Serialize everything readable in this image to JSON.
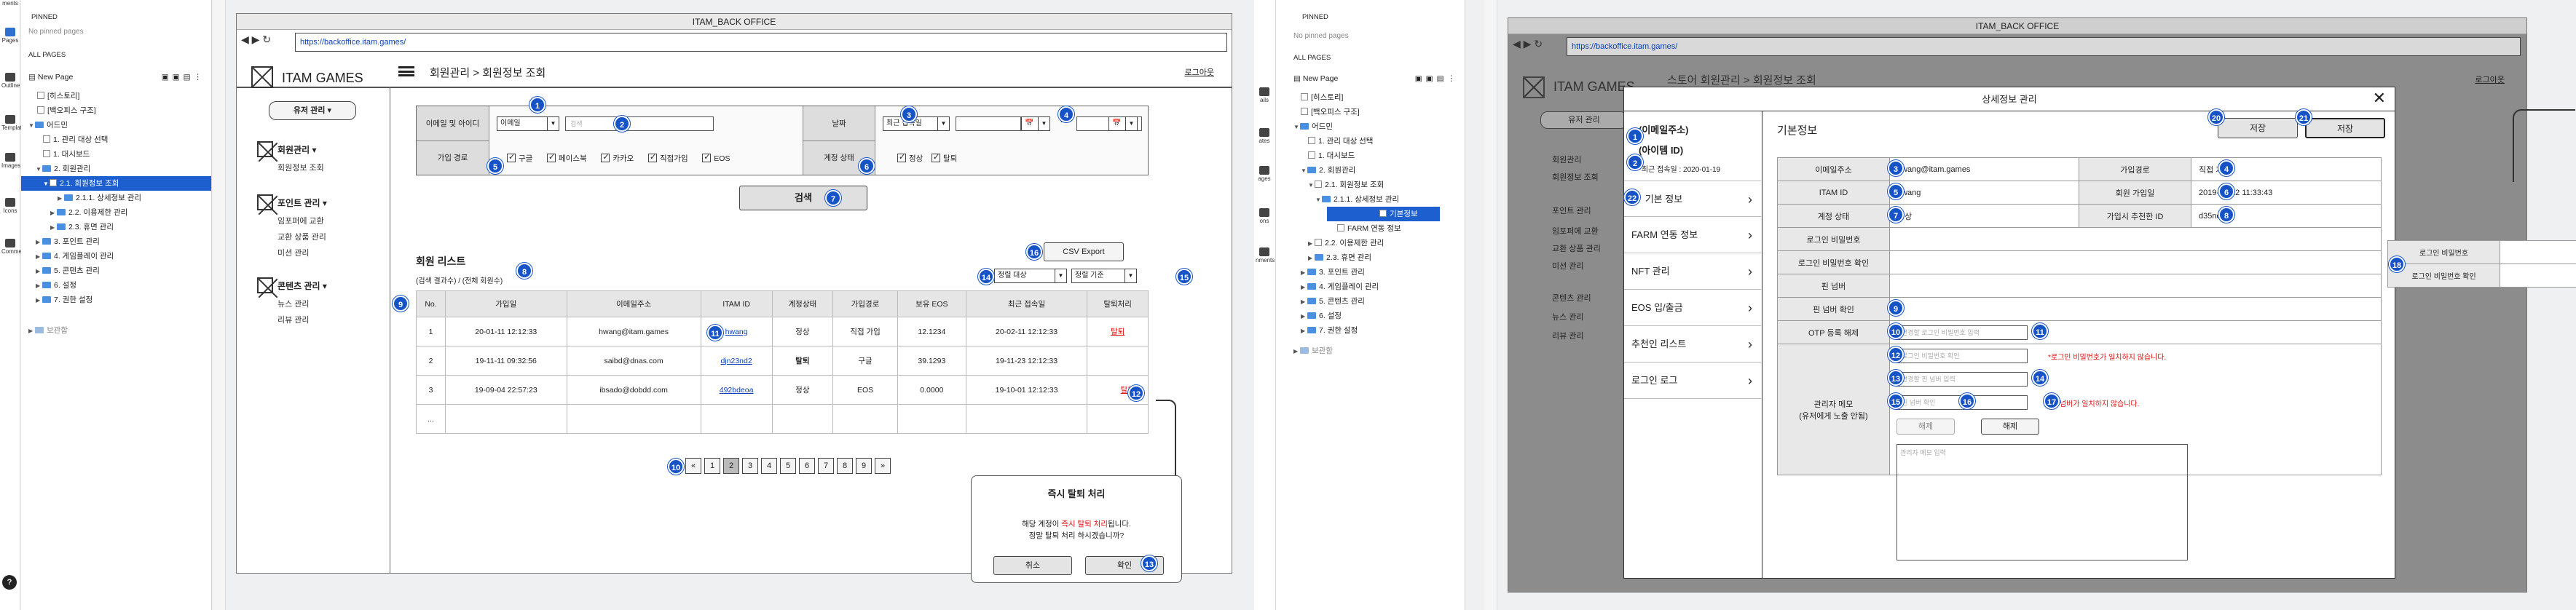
{
  "left_pane": {
    "rail": [
      "ments",
      "Pages",
      "Outline",
      "Templates",
      "Images",
      "Icons",
      "Comments"
    ],
    "pinned": "PINNED",
    "no_pinned": "No pinned pages",
    "all_pages": "ALL PAGES",
    "new_page": "New Page",
    "tree": [
      "[히스토리]",
      "[백오피스 구조]",
      "어드민",
      "1. 관리 대상 선택",
      "1. 대시보드",
      "2. 회원관리",
      "2.1. 회원정보 조회",
      "2.1.1. 상세정보 관리",
      "2.2. 이용제한 관리",
      "2.3. 휴면 관리",
      "3. 포인트 관리",
      "4. 게임플레이 관리",
      "5. 콘텐츠 관리",
      "6. 설정",
      "7. 권한 설정",
      "보관함"
    ]
  },
  "main1": {
    "window_title": "ITAM_BACK OFFICE",
    "url": "https://backoffice.itam.games/",
    "logo": "ITAM GAMES",
    "breadcrumb": "회원관리 > 회원정보 조회",
    "logout": "로그아웃",
    "user_menu": "유저 관리",
    "side": {
      "g1": "회원관리",
      "g1_items": [
        "회원정보 조회"
      ],
      "g2": "포인트 관리",
      "g2_items": [
        "임포퍼에 교환",
        "교환 상품 관리",
        "미션 관리"
      ],
      "g3": "콘텐츠 관리",
      "g3_items": [
        "뉴스 관리",
        "리뷰 관리"
      ]
    },
    "filter": {
      "label_email": "이메일 및 아이디",
      "email_select": "이메일",
      "search_placeholder": "검색",
      "label_date": "날짜",
      "date_select": "최근 접속일",
      "tilde": "~",
      "label_signup": "가입 경로",
      "signup": [
        "구글",
        "페이스북",
        "카카오",
        "직접가입",
        "EOS"
      ],
      "label_status": "계정 상태",
      "status": [
        "정상",
        "탈퇴"
      ],
      "search_btn": "검색"
    },
    "list": {
      "title": "회원 리스트",
      "sub": "(검색 결과수) / (전체 회원수)",
      "csv": "CSV Export",
      "sort1": "정렬 대상",
      "sort2": "정렬 기준",
      "headers": [
        "No.",
        "가입일",
        "이메일주소",
        "ITAM ID",
        "계정상태",
        "가입경로",
        "보유 EOS",
        "최근 접속일",
        "탈퇴처리"
      ],
      "rows": [
        [
          "1",
          "20-01-11 12:12:33",
          "hwang@itam.games",
          "hwang",
          "정상",
          "직접 가입",
          "12.1234",
          "20-02-11 12:12:33",
          "탈퇴"
        ],
        [
          "2",
          "19-11-11 09:32:56",
          "saibd@dnas.com",
          "djn23nd2",
          "탈퇴",
          "구글",
          "39.1293",
          "19-11-23 12:12:33",
          ""
        ],
        [
          "3",
          "19-09-04 22:57:23",
          "ibsado@dobdd.com",
          "492bdeoa",
          "정상",
          "EOS",
          "0.0000",
          "19-10-01 12:12:33",
          "탈퇴"
        ],
        [
          "...",
          "",
          "",
          "",
          "",
          "",
          "",
          "",
          ""
        ]
      ],
      "pages": [
        "«",
        "1",
        "2",
        "3",
        "4",
        "5",
        "6",
        "7",
        "8",
        "9",
        "»"
      ]
    },
    "popup": {
      "title": "즉시 탈퇴 처리",
      "line1_a": "해당 계정이 ",
      "line1_red": "즉시 탈퇴 처리",
      "line1_b": "됩니다.",
      "line2": "정말 탈퇴 처리 하시겠습니까?",
      "cancel": "취소",
      "ok": "확인"
    },
    "badges": [
      "1",
      "2",
      "3",
      "4",
      "5",
      "6",
      "7",
      "8",
      "9",
      "10",
      "11",
      "12",
      "13",
      "14",
      "15",
      "16"
    ]
  },
  "mid_pane": {
    "tree": [
      "[히스토리]",
      "[백오피스 구조]",
      "어드민",
      "1. 관리 대상 선택",
      "1. 대시보드",
      "2. 회원관리",
      "2.1. 회원정보 조회",
      "2.1.1. 상세정보 관리",
      "기본정보",
      "FARM 연동 정보",
      "2.2. 이용제한 관리",
      "2.3. 휴면 관리",
      "3. 포인트 관리",
      "4. 게임플레이 관리",
      "5. 콘텐츠 관리",
      "6. 설정",
      "7. 권한 설정",
      "보관함"
    ],
    "rail": [
      "ails",
      "ates",
      "ages",
      "ons",
      "nments"
    ]
  },
  "main2": {
    "window_title": "ITAM_BACK OFFICE",
    "url": "https://backoffice.itam.games/",
    "logo": "ITAM GAMES",
    "breadcrumb": "스토어 회원관리 > 회원정보 조회",
    "logout": "로그아웃",
    "user_menu": "유저 관리",
    "side_bg": [
      "회원관리",
      "회원정보 조회",
      "포인트 관리",
      "임포퍼에 교환",
      "교환 상품 관리",
      "미션 관리",
      "콘텐츠 관리",
      "뉴스 관리",
      "리뷰 관리"
    ],
    "modal": {
      "title": "상세정보 관리",
      "email_hdr": "(이메일주소)",
      "id_hdr": "(아이템 ID)",
      "last_login": "*최근 접속일 : 2020-01-19",
      "tabs": [
        "기본 정보",
        "FARM 연동 정보",
        "NFT 관리",
        "EOS 입/출금",
        "추천인 리스트",
        "로그인 로그"
      ],
      "section": "기본정보",
      "save1": "저장",
      "save2": "저장",
      "f": {
        "email_k": "이메일주소",
        "email_v": "hwang@itam.games",
        "route_k": "가입경로",
        "route_v": "직접 가입",
        "id_k": "ITAM ID",
        "id_v": "hwang",
        "joined_k": "회원 가입일",
        "joined_v": "2019-03-12 11:33:43",
        "status_k": "계정 상태",
        "status_v": "정상",
        "ref_k": "가입시 추천한 ID",
        "ref_v": "d35nod2i",
        "pw_k": "로그인 비밀번호",
        "pw_ph": "변경할 로그인 비밀번호 입력",
        "pw2_k": "로그인 비밀번호 확인",
        "pw2_ph": "로그인 비밀번호 확인",
        "pw_err": "*로그인 비밀번호가 일치하지 않습니다.",
        "pin_k": "핀 넘버",
        "pin_ph": "변경할 핀 넘버 입력",
        "pin2_k": "핀 넘버 확인",
        "pin2_ph": "핀 넘버 확인",
        "pin_err": "*핀 넘버가 일치하지 않습니다.",
        "otp_k": "OTP 등록 해제",
        "otp_b1": "해제",
        "otp_b2": "해제",
        "memo_k1": "관리자 메모",
        "memo_k2": "(유저에게 노출 안됨)",
        "memo_ph": "관리자 메모 입력"
      },
      "side_panel": [
        "로그인 비밀번호",
        "로그인 비밀번호 확인"
      ],
      "badges": [
        "1",
        "2",
        "3",
        "4",
        "5",
        "6",
        "7",
        "8",
        "9",
        "10",
        "11",
        "12",
        "13",
        "14",
        "15",
        "16",
        "17",
        "18",
        "20",
        "21",
        "22"
      ]
    }
  }
}
